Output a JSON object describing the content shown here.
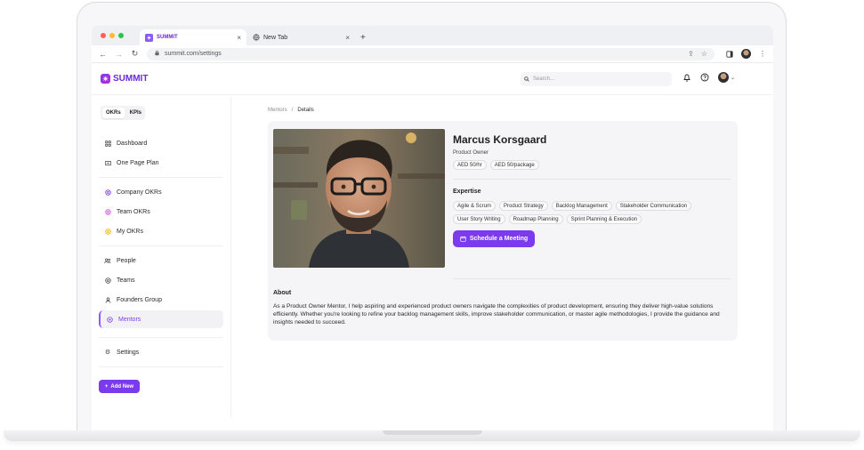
{
  "browser": {
    "tabs": [
      {
        "label": "SUMMIT",
        "active": true
      },
      {
        "label": "New Tab",
        "active": false
      }
    ],
    "new_tab_symbol": "+",
    "url": "summit.com/settings"
  },
  "app": {
    "logo_text": "SUMMIT",
    "search_placeholder": "Search...",
    "accent_color": "#7c3aed"
  },
  "sidebar": {
    "segment": {
      "okrs": "OKRs",
      "kpis": "KPIs"
    },
    "group1": [
      {
        "label": "Dashboard",
        "icon": "grid-icon"
      },
      {
        "label": "One Page Plan",
        "icon": "page-icon"
      }
    ],
    "group2": [
      {
        "label": "Company OKRs",
        "icon": "target-icon"
      },
      {
        "label": "Team OKRs",
        "icon": "target-icon"
      },
      {
        "label": "My OKRs",
        "icon": "target-icon"
      }
    ],
    "group3": [
      {
        "label": "People",
        "icon": "people-icon"
      },
      {
        "label": "Teams",
        "icon": "teams-icon"
      },
      {
        "label": "Founders Group",
        "icon": "user-icon"
      },
      {
        "label": "Mentors",
        "icon": "mentor-icon",
        "active": true
      }
    ],
    "group4": [
      {
        "label": "Settings",
        "icon": "gear-icon"
      }
    ],
    "add_button": "Add New"
  },
  "breadcrumb": {
    "parent": "Mentors",
    "sep": "/",
    "current": "Details"
  },
  "mentor": {
    "name": "Marcus Korsgaard",
    "role": "Product Owner",
    "rates": [
      "AED 50/hr",
      "AED 50/package"
    ],
    "expertise_title": "Expertise",
    "skills": [
      "Agile & Scrum",
      "Product Strategy",
      "Backlog Management",
      "Stakeholder Communication",
      "User Story Writing",
      "Roadmap Planning",
      "Sprint Planning & Execution"
    ],
    "schedule_button": "Schedule a Meeting",
    "about_title": "About",
    "about_text": "As a Product Owner Mentor, I help aspiring and experienced product owners navigate the complexities of product development, ensuring they deliver high-value solutions efficiently. Whether you're looking to refine your backlog management skills, improve stakeholder communication, or master agile methodologies, I provide the guidance and insights needed to succeed."
  }
}
